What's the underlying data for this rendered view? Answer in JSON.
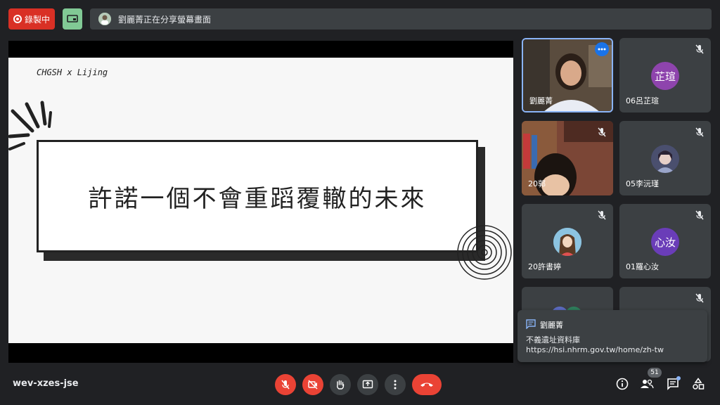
{
  "top_bar": {
    "recording_label": "錄製中",
    "share_banner": "劉麗菁正在分享螢幕畫面"
  },
  "slide": {
    "brand": "CHGSH x Lijing",
    "title": "許諾一個不會重蹈覆轍的未來"
  },
  "participants": [
    {
      "name": "劉麗菁"
    },
    {
      "name": "06呂芷瑄",
      "initials": "芷瑄",
      "color": "#8e44ad"
    },
    {
      "name": "20郭"
    },
    {
      "name": "05李沅瑾"
    },
    {
      "name": "20許書婷"
    },
    {
      "name": "01羅心汝",
      "initials": "心汝",
      "color": "#6a3db8"
    }
  ],
  "chat": {
    "sender": "劉麗菁",
    "line1": "不義遺址資料庫",
    "line2": "https://hsi.nhrm.gov.tw/home/zh-tw"
  },
  "bottom_bar": {
    "meeting_code": "wev-xzes-jse",
    "participant_count": "51"
  },
  "colors": {
    "accent_red": "#ea4335",
    "recording_red": "#d93025",
    "active_speaker_border": "#8ab4f8",
    "panel_grey": "#3c4043"
  }
}
